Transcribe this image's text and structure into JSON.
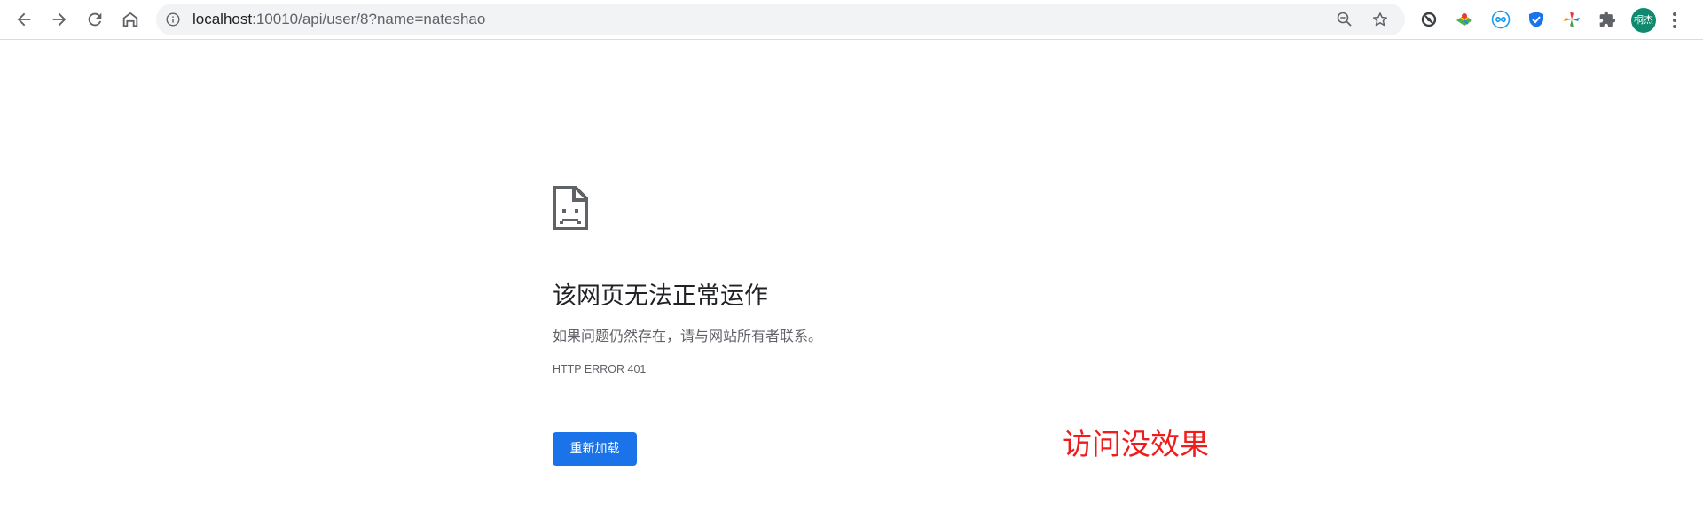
{
  "browser": {
    "url_host": "localhost",
    "url_path": ":10010/api/user/8?name=nateshao",
    "avatar_text": "桐杰",
    "icons": {
      "back": "back-arrow-icon",
      "forward": "forward-arrow-icon",
      "reload": "reload-icon",
      "home": "home-icon",
      "site_info": "info-icon",
      "zoom": "zoom-out-icon",
      "bookmark": "star-icon",
      "extensions": [
        "sync-extension-icon",
        "map-extension-icon",
        "infinity-extension-icon",
        "shield-extension-icon",
        "pinwheel-extension-icon",
        "puzzle-icon"
      ],
      "menu": "kebab-menu-icon"
    }
  },
  "error_page": {
    "title": "该网页无法正常运作",
    "message": "如果问题仍然存在，请与网站所有者联系。",
    "error_code": "HTTP ERROR 401",
    "reload_button": "重新加载",
    "icon": "sad-page-icon"
  },
  "annotation": {
    "text": "访问没效果",
    "color": "#ee1c1c"
  },
  "colors": {
    "accent": "#1a73e8",
    "avatar_bg": "#0f8a6f"
  }
}
